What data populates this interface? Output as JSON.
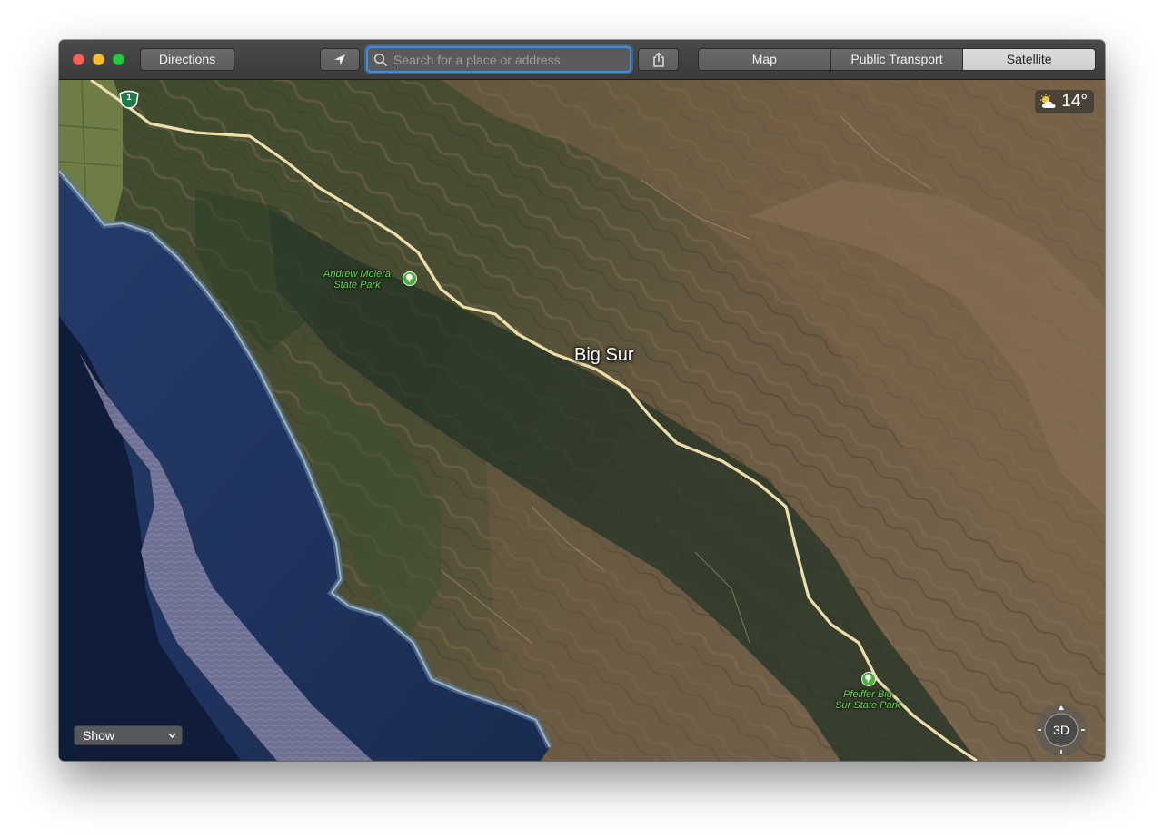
{
  "toolbar": {
    "directions_label": "Directions",
    "search_placeholder": "Search for a place or address",
    "search_value": "",
    "view_modes": [
      "Map",
      "Public Transport",
      "Satellite"
    ],
    "active_view": "Satellite"
  },
  "weather": {
    "temperature": "14°",
    "icon": "partly-cloudy-icon"
  },
  "map": {
    "city_label": "Big Sur",
    "parks": [
      {
        "name_line1": "Andrew Molera",
        "name_line2": "State Park"
      },
      {
        "name_line1": "Pfeiffer Big",
        "name_line2": "Sur State Park"
      }
    ],
    "highway_number": "1"
  },
  "controls": {
    "compass_label": "3D",
    "zoom_out_label": "−",
    "zoom_in_label": "+",
    "show_label": "Show"
  },
  "colors": {
    "search_focus": "#3f8fd8",
    "park_label": "#6fd35a",
    "road": "#eedfa8",
    "ocean": "#1c2f5c"
  }
}
